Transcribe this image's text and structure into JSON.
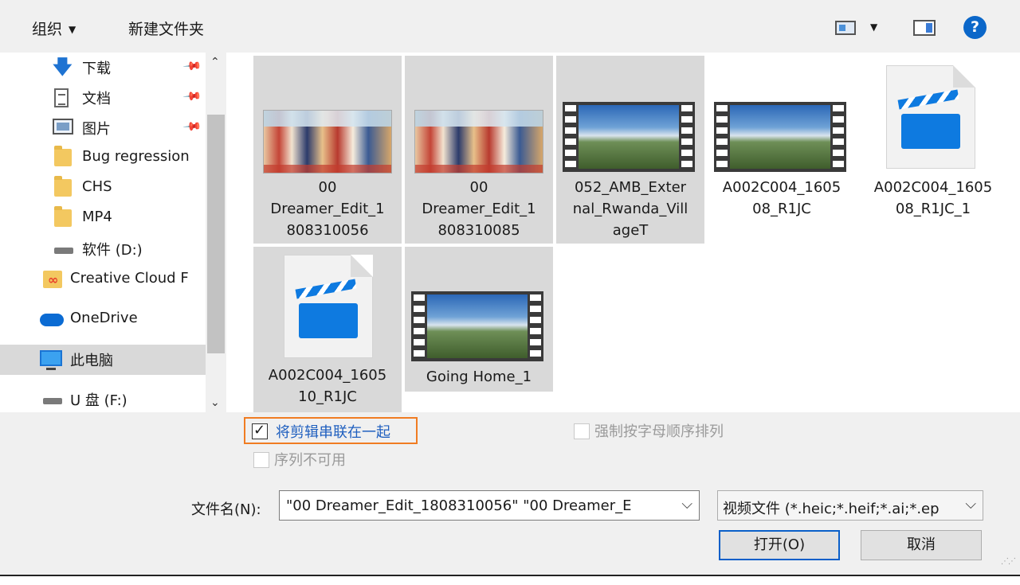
{
  "toolbar": {
    "organize_label": "组织",
    "new_folder_label": "新建文件夹",
    "help_glyph": "?"
  },
  "nav": {
    "items": [
      {
        "label": "下载",
        "icon": "download-icon",
        "pinned": true
      },
      {
        "label": "文档",
        "icon": "document-icon",
        "pinned": true
      },
      {
        "label": "图片",
        "icon": "pictures-icon",
        "pinned": true
      },
      {
        "label": "Bug regression",
        "icon": "folder-icon"
      },
      {
        "label": "CHS",
        "icon": "folder-icon"
      },
      {
        "label": "MP4",
        "icon": "folder-icon"
      },
      {
        "label": "软件 (D:)",
        "icon": "drive-icon"
      },
      {
        "label": "Creative Cloud F",
        "icon": "creative-cloud-icon"
      },
      {
        "label": "OneDrive",
        "icon": "onedrive-icon"
      },
      {
        "label": "此电脑",
        "icon": "this-pc-icon",
        "selected": true
      },
      {
        "label": "U 盘 (F:)",
        "icon": "usb-drive-icon"
      }
    ]
  },
  "files": [
    {
      "name": "00 Dreamer_Edit_1808310056",
      "line1": "00",
      "line2": "Dreamer_Edit_1",
      "line3": "808310056",
      "thumb": "image",
      "selected": true
    },
    {
      "name": "00 Dreamer_Edit_1808310085",
      "line1": "00",
      "line2": "Dreamer_Edit_1",
      "line3": "808310085",
      "thumb": "image",
      "selected": true
    },
    {
      "name": "052_AMB_External_Rwanda_VillageT",
      "line1": "052_AMB_Exter",
      "line2": "nal_Rwanda_Vill",
      "line3": "ageT",
      "thumb": "video",
      "selected": true
    },
    {
      "name": "A002C004_160508_R1JC",
      "line1": "A002C004_1605",
      "line2": "08_R1JC",
      "line3": "",
      "thumb": "video",
      "selected": false
    },
    {
      "name": "A002C004_160508_R1JC_1",
      "line1": "A002C004_1605",
      "line2": "08_R1JC_1",
      "line3": "",
      "thumb": "clapper",
      "selected": false
    },
    {
      "name": "A002C004_160510_R1JC",
      "line1": "A002C004_1605",
      "line2": "10_R1JC",
      "line3": "",
      "thumb": "clapper",
      "selected": true
    },
    {
      "name": "Going Home_1",
      "line1": "Going Home_1",
      "line2": "",
      "line3": "",
      "thumb": "video",
      "selected": true
    }
  ],
  "options": {
    "join_clips_label": "将剪辑串联在一起",
    "join_clips_checked": true,
    "force_alpha_label": "强制按字母顺序排列",
    "sequence_unavailable_label": "序列不可用"
  },
  "filename": {
    "label": "文件名(N):",
    "value": "\"00 Dreamer_Edit_1808310056\" \"00 Dreamer_E"
  },
  "filetype": {
    "value": "视频文件 (*.heic;*.heif;*.ai;*.ep"
  },
  "buttons": {
    "open_label": "打开(O)",
    "cancel_label": "取消"
  },
  "colors": {
    "accent": "#0b67c9",
    "selection": "#d9d9d9",
    "focus_outline": "#f07c22"
  }
}
